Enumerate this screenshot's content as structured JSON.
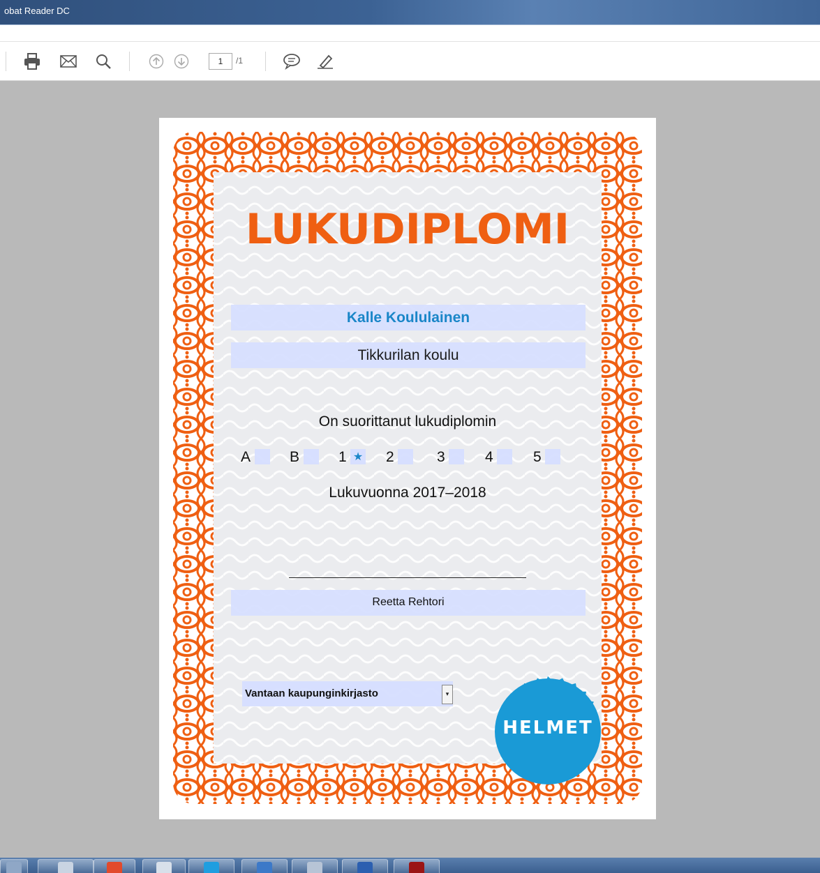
{
  "window": {
    "title": "obat Reader DC"
  },
  "toolbar": {
    "page_current": "1",
    "page_total": "/1"
  },
  "diploma": {
    "title": "LUKUDIPLOMI",
    "student_name": "Kalle Koululainen",
    "school": "Tikkurilan koulu",
    "completed_text": "On suorittanut lukudiplomin",
    "levels": [
      "A",
      "B",
      "1",
      "2",
      "3",
      "4",
      "5"
    ],
    "checked_mark": "★",
    "school_year": "Lukuvuonna 2017–2018",
    "signer": "Reetta Rehtori",
    "library": "Vantaan kaupunginkirjasto",
    "seal": "HELMET"
  },
  "colors": {
    "accent_orange": "#ef5f12",
    "field_blue": "#d6deff",
    "name_blue": "#1a86c8",
    "seal_blue": "#1a9ad6"
  }
}
